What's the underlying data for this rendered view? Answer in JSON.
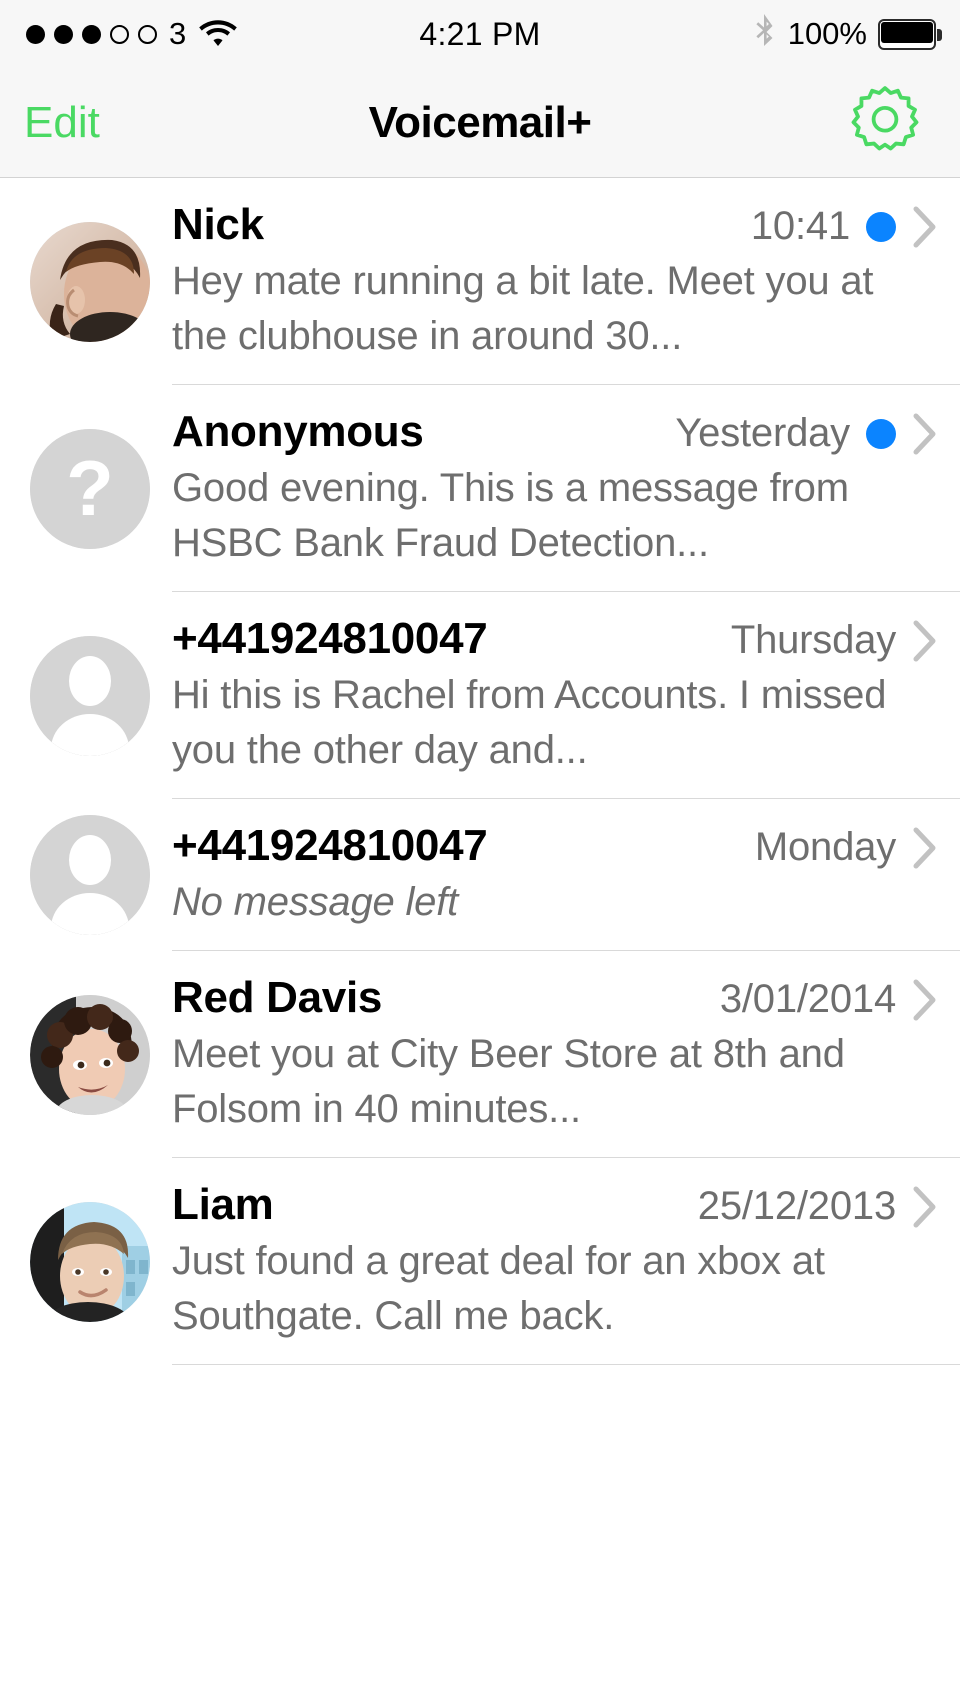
{
  "status_bar": {
    "signal_dots_filled": 3,
    "signal_dots_total": 5,
    "carrier": "3",
    "wifi_icon": "wifi-icon",
    "time": "4:21 PM",
    "bluetooth_icon": "bluetooth-icon",
    "battery_percent": "100%",
    "battery_level": 100
  },
  "nav": {
    "edit_label": "Edit",
    "title": "Voicemail+",
    "settings_icon": "gear-icon",
    "accent_color": "#4ad963"
  },
  "colors": {
    "unread_blue": "#0b84ff",
    "accent_green": "#4ad963",
    "secondary_text": "#6e6e6e",
    "separator": "#d9d9d9",
    "bar_background": "#f7f7f7"
  },
  "voicemails": [
    {
      "name": "Nick",
      "time": "10:41",
      "preview": "Hey mate running a bit late. Meet you at the clubhouse in around 30...",
      "unread": true,
      "avatar_type": "photo",
      "avatar_name": "avatar-nick",
      "no_message": false
    },
    {
      "name": "Anonymous",
      "time": "Yesterday",
      "preview": "Good evening. This is a message from HSBC Bank Fraud Detection...",
      "unread": true,
      "avatar_type": "question",
      "avatar_name": "avatar-anonymous",
      "no_message": false
    },
    {
      "name": "+441924810047",
      "time": "Thursday",
      "preview": "Hi this is Rachel from Accounts. I missed you the other day and...",
      "unread": false,
      "avatar_type": "silhouette",
      "avatar_name": "avatar-unknown-contact",
      "no_message": false
    },
    {
      "name": "+441924810047",
      "time": "Monday",
      "preview": "No message left",
      "unread": false,
      "avatar_type": "silhouette",
      "avatar_name": "avatar-unknown-contact",
      "no_message": true
    },
    {
      "name": "Red Davis",
      "time": "3/01/2014",
      "preview": "Meet you at City Beer Store at 8th and Folsom in 40 minutes...",
      "unread": false,
      "avatar_type": "photo",
      "avatar_name": "avatar-red-davis",
      "no_message": false
    },
    {
      "name": "Liam",
      "time": "25/12/2013",
      "preview": "Just found a great deal for an xbox at Southgate. Call me back.",
      "unread": false,
      "avatar_type": "photo",
      "avatar_name": "avatar-liam",
      "no_message": false
    }
  ]
}
